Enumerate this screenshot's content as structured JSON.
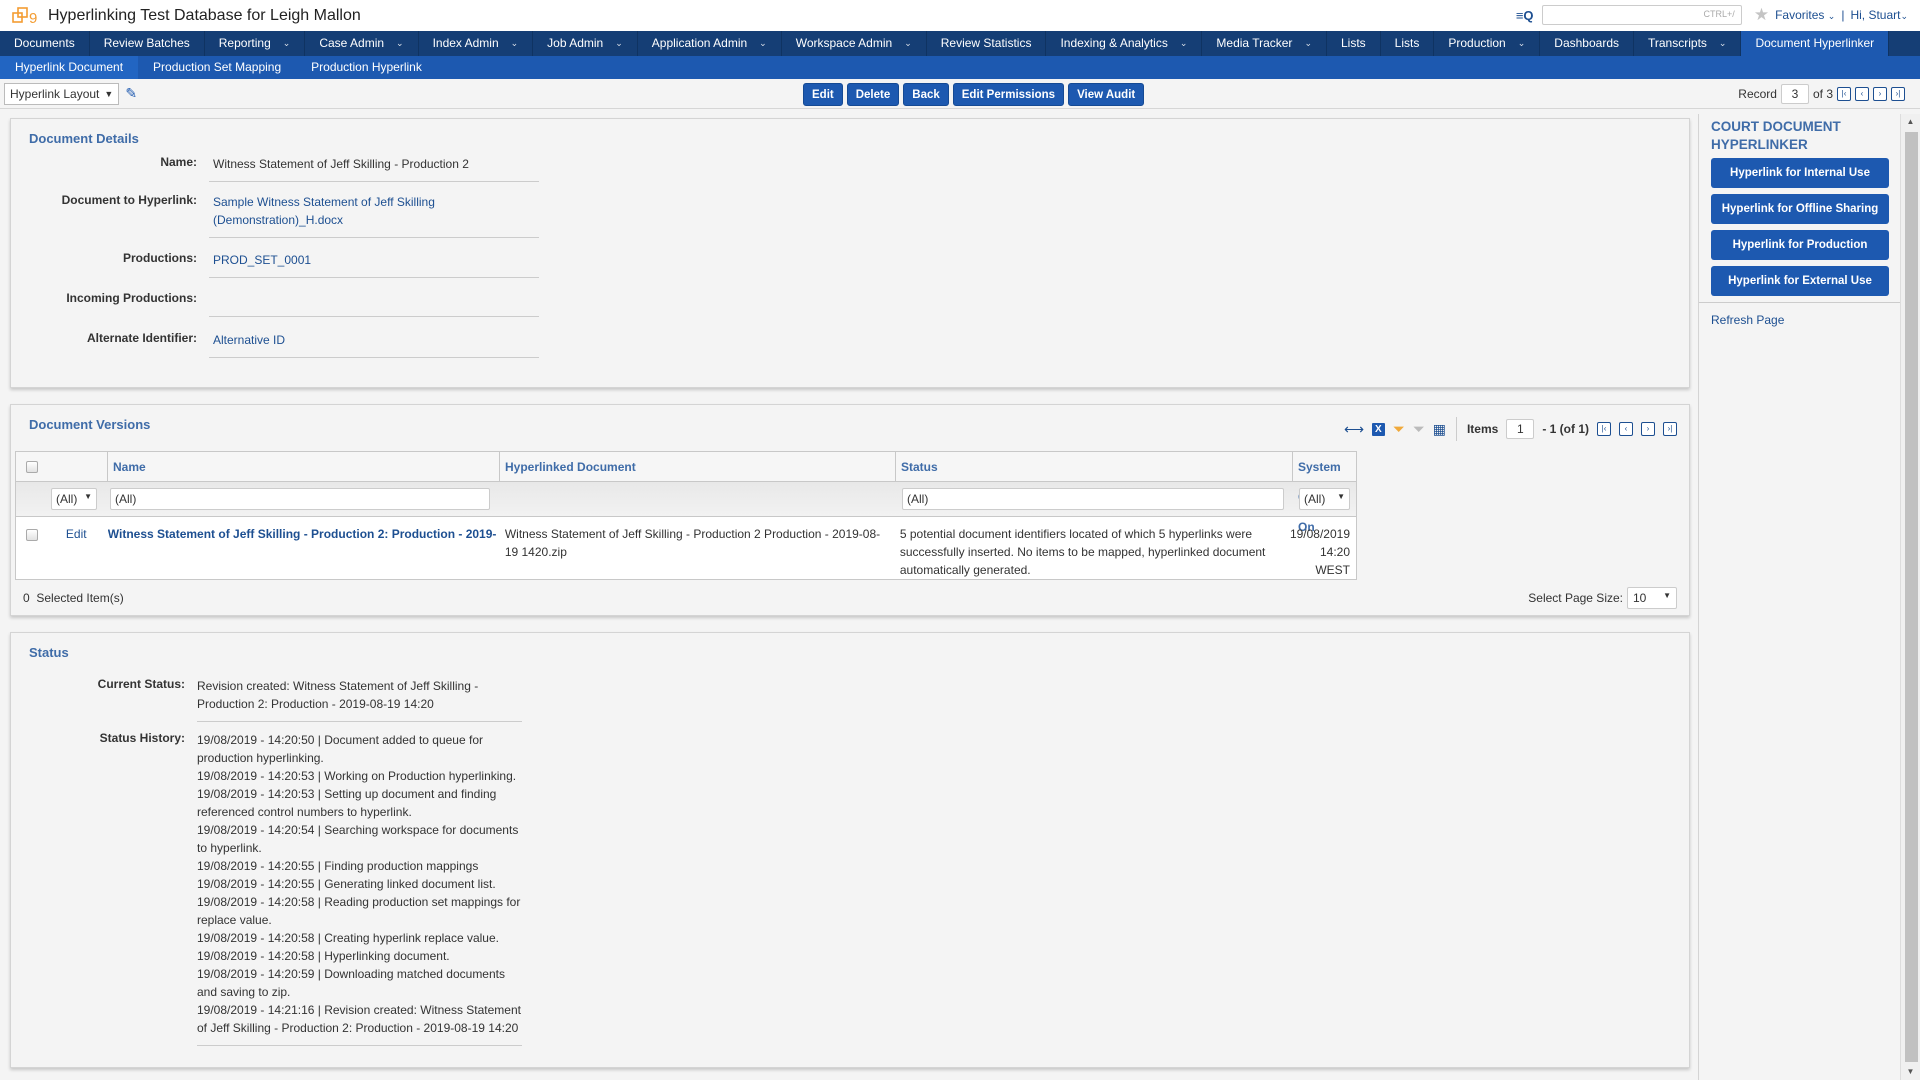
{
  "app": {
    "title": "Hyperlinking Test Database for Leigh Mallon",
    "search_shortcut": "CTRL+/",
    "favorites_label": "Favorites",
    "user_greeting": "Hi, Stuart",
    "brand_color": "#1d59b0"
  },
  "main_nav": [
    {
      "label": "Documents",
      "dropdown": false
    },
    {
      "label": "Review Batches",
      "dropdown": false
    },
    {
      "label": "Reporting",
      "dropdown": true
    },
    {
      "label": "Case Admin",
      "dropdown": true
    },
    {
      "label": "Index Admin",
      "dropdown": true
    },
    {
      "label": "Job Admin",
      "dropdown": true
    },
    {
      "label": "Application Admin",
      "dropdown": true
    },
    {
      "label": "Workspace Admin",
      "dropdown": true
    },
    {
      "label": "Review Statistics",
      "dropdown": false
    },
    {
      "label": "Indexing & Analytics",
      "dropdown": true
    },
    {
      "label": "Media Tracker",
      "dropdown": true
    },
    {
      "label": "Lists",
      "dropdown": false
    },
    {
      "label": "Lists",
      "dropdown": false
    },
    {
      "label": "Production",
      "dropdown": true
    },
    {
      "label": "Dashboards",
      "dropdown": false
    },
    {
      "label": "Transcripts",
      "dropdown": true
    },
    {
      "label": "Document Hyperlinker",
      "dropdown": false,
      "active": true
    }
  ],
  "sub_nav": [
    {
      "label": "Hyperlink Document",
      "active": true
    },
    {
      "label": "Production Set Mapping"
    },
    {
      "label": "Production Hyperlink"
    }
  ],
  "toolbar": {
    "layout_select": "Hyperlink Layout",
    "buttons": [
      "Edit",
      "Delete",
      "Back",
      "Edit Permissions",
      "View Audit"
    ],
    "record_label": "Record",
    "record_current": "3",
    "record_total": "of 3"
  },
  "document_details": {
    "title": "Document Details",
    "fields": [
      {
        "label": "Name:",
        "value": "Witness Statement of Jeff Skilling - Production 2",
        "link": false
      },
      {
        "label": "Document to Hyperlink:",
        "value": "Sample Witness Statement of Jeff Skilling (Demonstration)_H.docx",
        "link": true
      },
      {
        "label": "Productions:",
        "value": "PROD_SET_0001",
        "link": true
      },
      {
        "label": "Incoming Productions:",
        "value": "",
        "link": false
      },
      {
        "label": "Alternate Identifier:",
        "value": "Alternative ID",
        "link": true
      }
    ]
  },
  "document_versions": {
    "title": "Document Versions",
    "items_label": "Items",
    "items_current": "1",
    "items_range": "- 1 (of 1)",
    "columns": [
      "Name",
      "Hyperlinked Document",
      "Status",
      "System Created On"
    ],
    "filters": {
      "edit_filter": "(All)",
      "name": "(All)",
      "status": "(All)",
      "created_on": "(All)"
    },
    "rows": [
      {
        "edit_label": "Edit",
        "name": "Witness Statement of Jeff Skilling - Production 2: Production - 2019-",
        "hyperlinked_document": "Witness Statement of Jeff Skilling - Production 2 Production - 2019-08-19 1420.zip",
        "status": "5 potential document identifiers located of which 5 hyperlinks were successfully inserted. No items to be mapped, hyperlinked document automatically generated.",
        "created_on": "19/08/2019 14:20 WEST"
      }
    ],
    "selected_count": "0",
    "selected_label": "Selected Item(s)",
    "page_size_label": "Select Page Size:",
    "page_size": "10"
  },
  "status": {
    "title": "Status",
    "current_label": "Current Status:",
    "current_value": "Revision created: Witness Statement of Jeff Skilling - Production 2: Production - 2019-08-19 14:20",
    "history_label": "Status History:",
    "history": [
      "19/08/2019 - 14:20:50 | Document added to queue for production hyperlinking.",
      "19/08/2019 - 14:20:53 | Working on Production hyperlinking.",
      "19/08/2019 - 14:20:53 | Setting up document and finding referenced control numbers to hyperlink.",
      "19/08/2019 - 14:20:54 | Searching workspace for documents to hyperlink.",
      "19/08/2019 - 14:20:55 | Finding production mappings",
      "19/08/2019 - 14:20:55 | Generating linked document list.",
      "19/08/2019 - 14:20:58 | Reading production set mappings for replace value.",
      "19/08/2019 - 14:20:58 | Creating hyperlink replace value.",
      "19/08/2019 - 14:20:58 | Hyperlinking document.",
      "19/08/2019 - 14:20:59 | Downloading matched documents and saving to zip.",
      "19/08/2019 - 14:21:16 | Revision created: Witness Statement of Jeff Skilling - Production 2: Production - 2019-08-19 14:20"
    ]
  },
  "sidebar": {
    "title": "COURT DOCUMENT HYPERLINKER",
    "buttons": [
      "Hyperlink for Internal Use",
      "Hyperlink for Offline Sharing",
      "Hyperlink for Production",
      "Hyperlink for External Use"
    ],
    "refresh_label": "Refresh Page"
  }
}
